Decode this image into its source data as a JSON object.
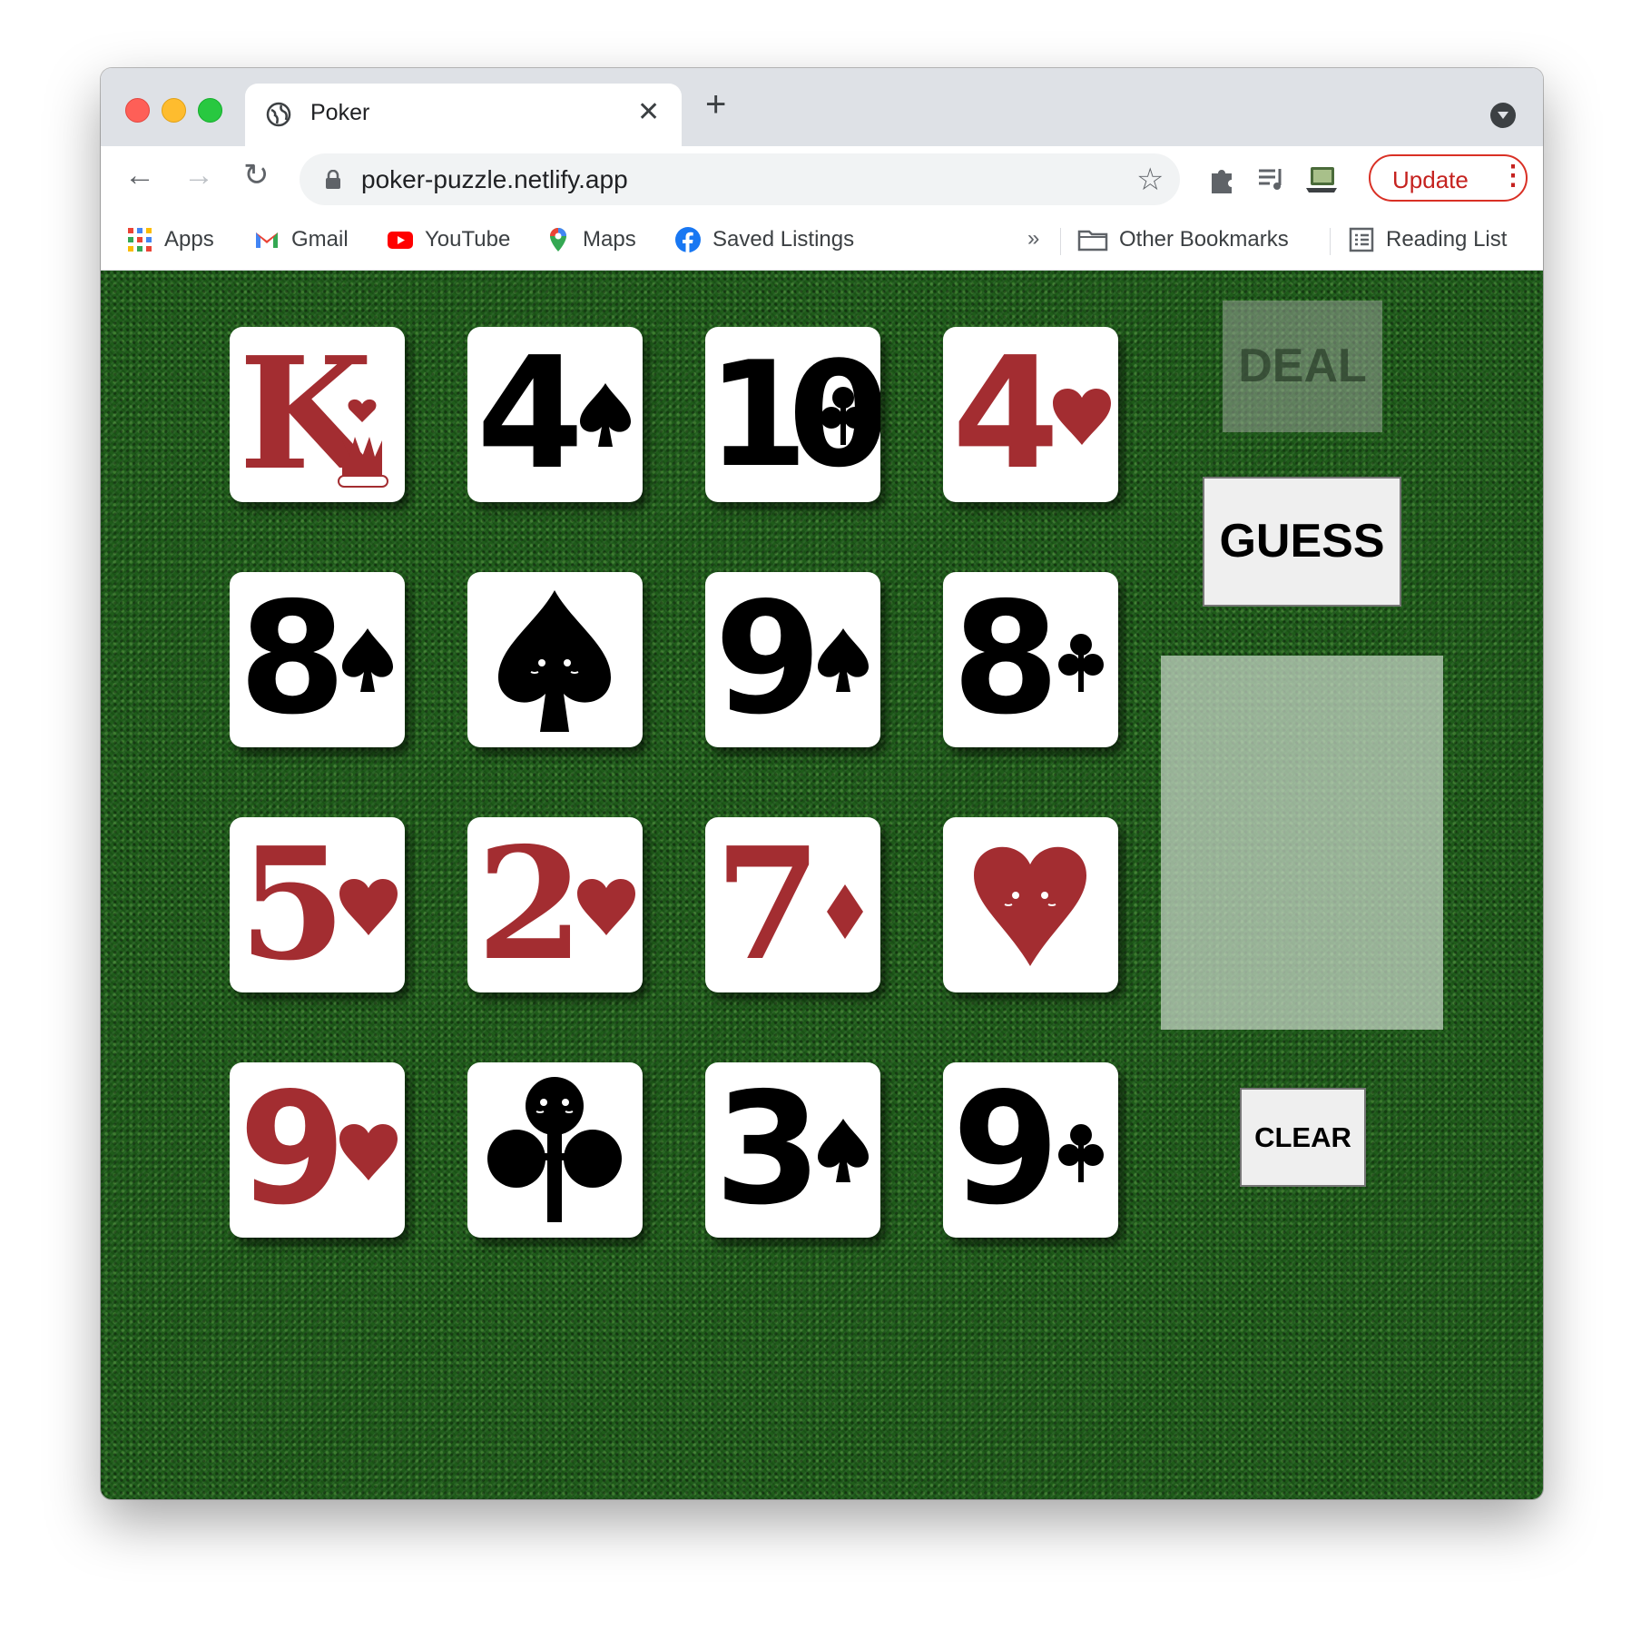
{
  "browser": {
    "tab_title": "Poker",
    "tab_close": "✕",
    "new_tab": "+",
    "url": "poker-puzzle.netlify.app",
    "update_label": "Update",
    "update_menu": "⋮",
    "back": "←",
    "forward": "→",
    "reload": "↻",
    "star": "☆"
  },
  "bookmarks": {
    "apps": "Apps",
    "gmail": "Gmail",
    "youtube": "YouTube",
    "maps": "Maps",
    "saved_listings": "Saved Listings",
    "overflow": "»",
    "other_bookmarks": "Other Bookmarks",
    "reading_list": "Reading List"
  },
  "game": {
    "deal_label": "DEAL",
    "guess_label": "GUESS",
    "clear_label": "CLEAR",
    "cards": [
      {
        "rank": "K",
        "suit": "hearts",
        "color": "red"
      },
      {
        "rank": "4",
        "suit": "spades",
        "color": "black"
      },
      {
        "rank": "10",
        "suit": "clubs",
        "color": "black"
      },
      {
        "rank": "4",
        "suit": "hearts",
        "color": "red"
      },
      {
        "rank": "8",
        "suit": "spades",
        "color": "black"
      },
      {
        "rank": "",
        "suit": "spades",
        "color": "black",
        "face": true
      },
      {
        "rank": "9",
        "suit": "spades",
        "color": "black"
      },
      {
        "rank": "8",
        "suit": "clubs",
        "color": "black"
      },
      {
        "rank": "5",
        "suit": "hearts",
        "color": "red"
      },
      {
        "rank": "2",
        "suit": "hearts",
        "color": "red"
      },
      {
        "rank": "7",
        "suit": "diamonds",
        "color": "red"
      },
      {
        "rank": "",
        "suit": "hearts",
        "color": "red",
        "face": true
      },
      {
        "rank": "9",
        "suit": "hearts",
        "color": "red"
      },
      {
        "rank": "",
        "suit": "clubs",
        "color": "black",
        "face": true
      },
      {
        "rank": "3",
        "suit": "spades",
        "color": "black"
      },
      {
        "rank": "9",
        "suit": "clubs",
        "color": "black"
      }
    ]
  },
  "colors": {
    "felt": "#1f5c1a",
    "red_suit": "#a32d31",
    "black_suit": "#000000"
  }
}
